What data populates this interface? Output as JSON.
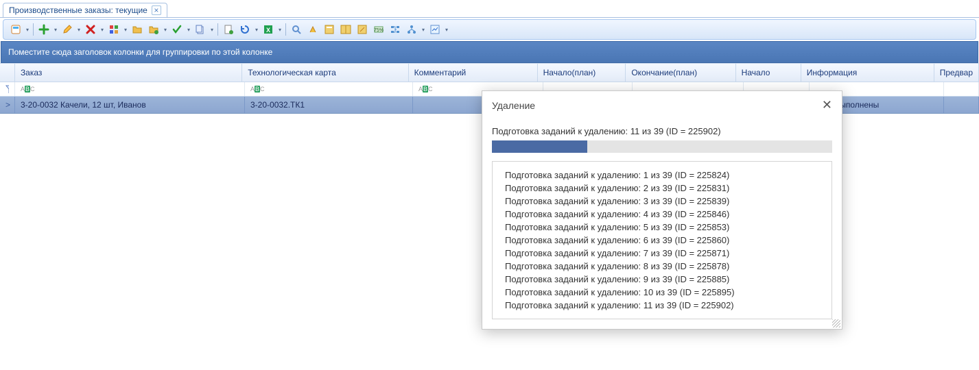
{
  "tab": {
    "title": "Производственные заказы: текущие"
  },
  "groupBar": {
    "text": "Поместите сюда заголовок колонки для группировки по этой колонке"
  },
  "columns": {
    "order": "Заказ",
    "tech": "Технологическая карта",
    "comment": "Комментарий",
    "startPlan": "Начало(план)",
    "endPlan": "Окончание(план)",
    "start": "Начало",
    "info": "Информация",
    "prev": "Предвар"
  },
  "row": {
    "marker": ">",
    "order": "3-20-0032 Качели, 12 шт, Иванов",
    "tech": "3-20-0032.ТК1",
    "comment": "",
    "startPlan": "",
    "endPlan": "",
    "start": "",
    "info": "ания выполнены",
    "prev": ""
  },
  "dialog": {
    "title": "Удаление",
    "progress": "Подготовка заданий к удалению: 11 из 39 (ID = 225902)",
    "progressPercent": 28,
    "log": [
      "Подготовка заданий к удалению: 1 из 39 (ID = 225824)",
      "Подготовка заданий к удалению: 2 из 39 (ID = 225831)",
      "Подготовка заданий к удалению: 3 из 39 (ID = 225839)",
      "Подготовка заданий к удалению: 4 из 39 (ID = 225846)",
      "Подготовка заданий к удалению: 5 из 39 (ID = 225853)",
      "Подготовка заданий к удалению: 6 из 39 (ID = 225860)",
      "Подготовка заданий к удалению: 7 из 39 (ID = 225871)",
      "Подготовка заданий к удалению: 8 из 39 (ID = 225878)",
      "Подготовка заданий к удалению: 9 из 39 (ID = 225885)",
      "Подготовка заданий к удалению: 10 из 39 (ID = 225895)",
      "Подготовка заданий к удалению: 11 из 39 (ID = 225902)"
    ]
  }
}
